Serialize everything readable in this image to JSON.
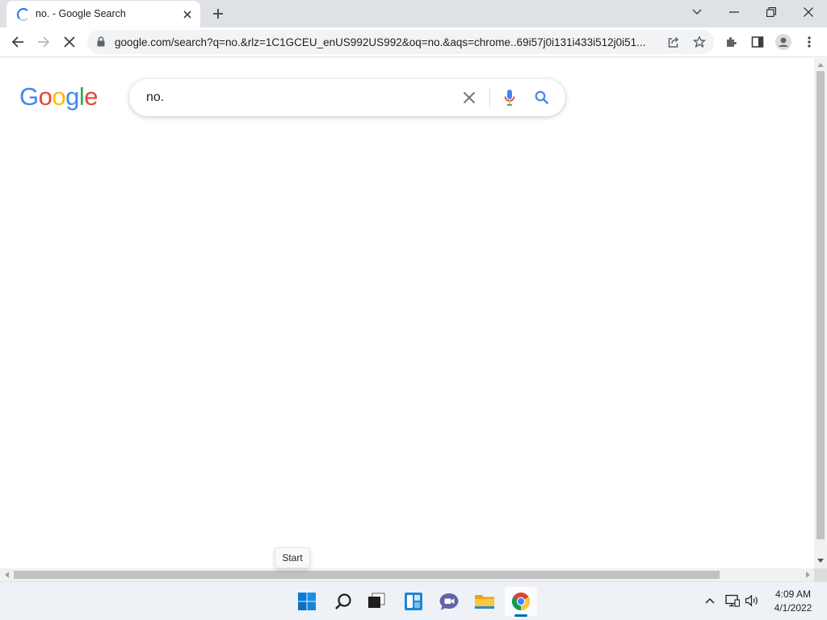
{
  "browser": {
    "tab": {
      "title": "no. - Google Search",
      "loading": true
    },
    "window_controls": [
      "chevron-down-icon",
      "minimize-icon",
      "restore-icon",
      "close-icon"
    ],
    "address_bar": {
      "url": "google.com/search?q=no.&rlz=1C1GCEU_enUS992US992&oq=no.&aqs=chrome..69i57j0i131i433i512j0i51..."
    }
  },
  "page": {
    "logo_letters": [
      {
        "char": "G",
        "color": "#4285F4"
      },
      {
        "char": "o",
        "color": "#EA4335"
      },
      {
        "char": "o",
        "color": "#FBBC05"
      },
      {
        "char": "g",
        "color": "#4285F4"
      },
      {
        "char": "l",
        "color": "#34A853"
      },
      {
        "char": "e",
        "color": "#EA4335"
      }
    ],
    "search": {
      "value": "no."
    }
  },
  "tooltip": {
    "text": "Start"
  },
  "taskbar": {
    "apps": [
      "start-icon",
      "search-icon",
      "task-view-icon",
      "widgets-icon",
      "teams-chat-icon",
      "file-explorer-icon",
      "chrome-icon"
    ],
    "active_app": "chrome-icon",
    "clock": {
      "time": "4:09 AM",
      "date": "4/1/2022"
    }
  },
  "colors": {
    "accent_blue": "#1a73e8",
    "taskbar_indicator": "#0067c0"
  }
}
